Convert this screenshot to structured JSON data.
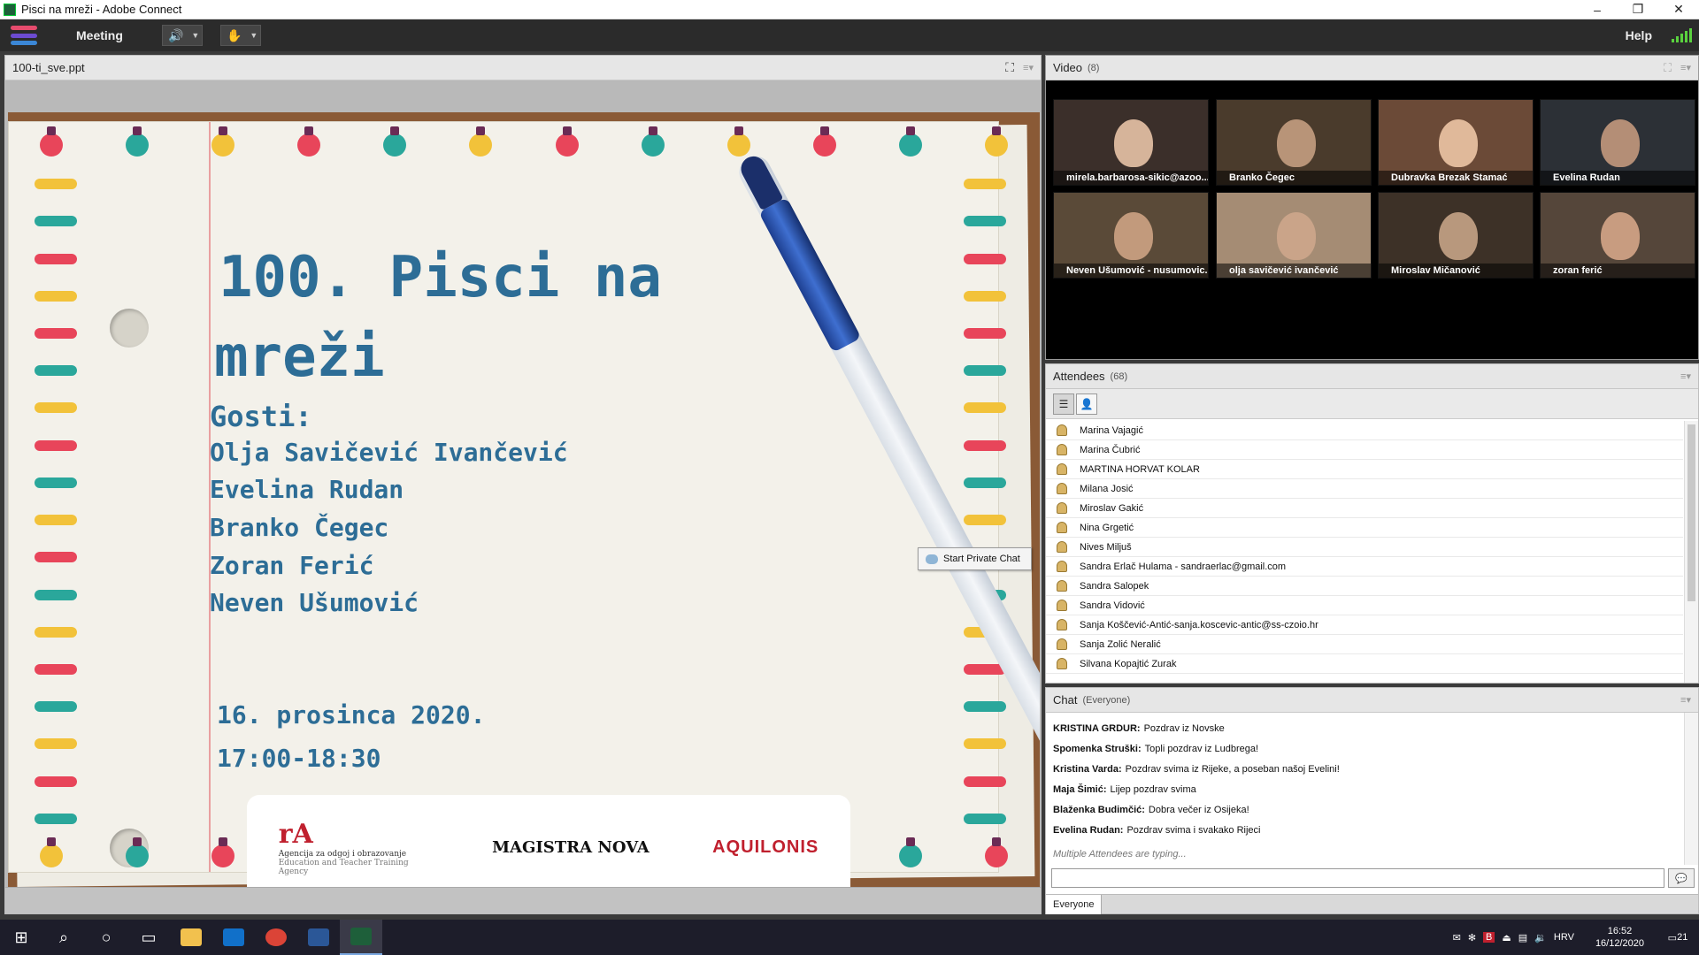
{
  "window": {
    "title": "Pisci na mreži - Adobe Connect",
    "minimize_glyph": "–",
    "restore_glyph": "❐",
    "close_glyph": "✕"
  },
  "menubar": {
    "meeting_label": "Meeting",
    "help_label": "Help",
    "speaker_icon": "speaker-icon",
    "camera_icon": "camera-icon"
  },
  "share_pod": {
    "title": "100-ti_sve.ppt",
    "slide": {
      "title_line1": "100. Pisci na",
      "title_line2": "mreži",
      "guests_heading": "Gosti:",
      "guests": [
        "Olja Savičević Ivančević",
        "Evelina Rudan",
        "Branko Čegec",
        "Zoran Ferić",
        "Neven Ušumović"
      ],
      "date": "16. prosinca 2020.",
      "time": "17:00-18:30",
      "logo_azoo_l1": "Agencija za odgoj i obrazovanje",
      "logo_azoo_l2": "Education and Teacher Training Agency",
      "logo_magistra": "MAGISTRA NOVA",
      "logo_aquilonis": "AQUILONIS"
    }
  },
  "tooltip": {
    "label": "Start Private Chat"
  },
  "video_pod": {
    "title": "Video",
    "count": "(8)",
    "tiles": [
      {
        "name": "mirela.barbarosa-sikic@azoo...",
        "bg": "#3b2f2a",
        "face": "#d6b49a"
      },
      {
        "name": "Branko Čegec",
        "bg": "#4a3b2c",
        "face": "#b89478"
      },
      {
        "name": "Dubravka Brezak Stamać",
        "bg": "#6b4a37",
        "face": "#e0b99a"
      },
      {
        "name": "Evelina Rudan",
        "bg": "#2c3036",
        "face": "#b48e76"
      },
      {
        "name": "Neven Ušumović - nusumovic...",
        "bg": "#5a4a38",
        "face": "#c29a7c"
      },
      {
        "name": "olja savičević ivančević",
        "bg": "#a58c74",
        "face": "#caa489"
      },
      {
        "name": "Miroslav Mičanović",
        "bg": "#3d3127",
        "face": "#b8987d"
      },
      {
        "name": "zoran ferić",
        "bg": "#55463a",
        "face": "#c89c80"
      }
    ]
  },
  "attendees_pod": {
    "title": "Attendees",
    "count": "(68)",
    "list": [
      "Marina Vajagić",
      "Marina Čubrić",
      "MARTINA HORVAT KOLAR",
      "Milana Josić",
      "Miroslav Gakić",
      "Nina Grgetić",
      "Nives Miljuš",
      "Sandra Erlač Hulama - sandraerlac@gmail.com",
      "Sandra Salopek",
      "Sandra Vidović",
      "Sanja Koščević-Antić-sanja.koscevic-antic@ss-czoio.hr",
      "Sanja Zolić Neralić",
      "Silvana Kopajtić Zurak"
    ]
  },
  "chat_pod": {
    "title": "Chat",
    "scope": "(Everyone)",
    "messages": [
      {
        "sender": "KRISTINA GRDUR:",
        "text": "Pozdrav iz Novske"
      },
      {
        "sender": "Spomenka Struški:",
        "text": "Topli pozdrav iz Ludbrega!"
      },
      {
        "sender": "Kristina Varda:",
        "text": "Pozdrav svima iz Rijeke, a poseban našoj Evelini!"
      },
      {
        "sender": "Maja Šimić:",
        "text": "Lijep pozdrav svima"
      },
      {
        "sender": "Blaženka Budimčić:",
        "text": "Dobra večer iz Osijeka!"
      },
      {
        "sender": "Evelina Rudan:",
        "text": "Pozdrav svima i svakako Rijeci"
      }
    ],
    "typing": "Multiple Attendees are typing...",
    "input_value": "",
    "tab_everyone": "Everyone"
  },
  "taskbar": {
    "lang": "HRV",
    "time": "16:52",
    "date": "16/12/2020",
    "notifications": "21"
  },
  "colors": {
    "accent_blue": "#2d6d96",
    "signal_green": "#5ad13e",
    "slide_wood": "#8a5a36"
  }
}
